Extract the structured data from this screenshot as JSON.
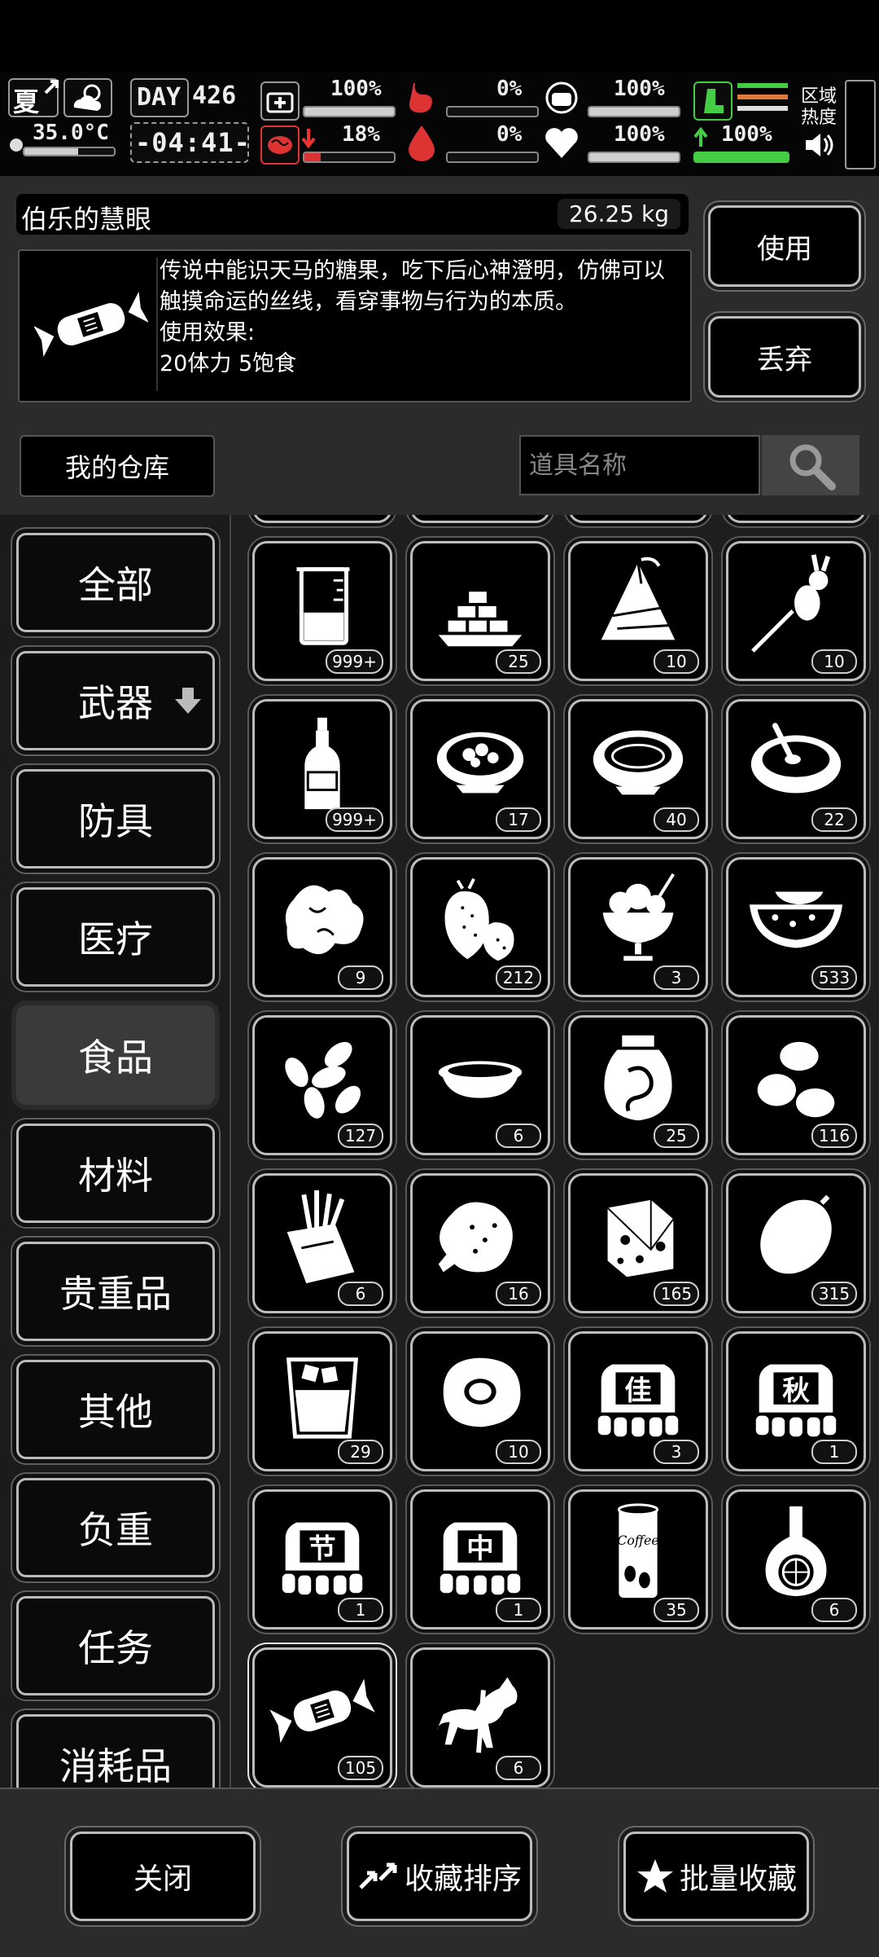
{
  "status": {
    "season": "夏",
    "temperature": "35.0°C",
    "day_label": "DAY",
    "day_number": "426",
    "time": "-04:41-",
    "stats": [
      {
        "name": "health",
        "text": "100%",
        "value": 100
      },
      {
        "name": "hunger",
        "text": "0%",
        "value": 0
      },
      {
        "name": "drink",
        "text": "100%",
        "value": 100
      },
      {
        "name": "brain",
        "text": "18%",
        "value": 18
      },
      {
        "name": "blood",
        "text": "0%",
        "value": 0
      },
      {
        "name": "heart",
        "text": "100%",
        "value": 100
      }
    ],
    "stamina": {
      "text": "100%",
      "value": 100
    },
    "zone_heat_label": "区域热度"
  },
  "detail": {
    "item_name": "伯乐的慧眼",
    "weight": "26.25 kg",
    "description": "传说中能识天马的糖果，吃下后心神澄明，仿佛可以触摸命运的丝线，看穿事物与行为的本质。",
    "effect_label": "使用效果:",
    "effect_value": "20体力 5饱食",
    "use_label": "使用",
    "discard_label": "丢弃"
  },
  "storage": {
    "title": "我的仓库",
    "search_placeholder": "道具名称"
  },
  "nav": [
    {
      "label": "全部"
    },
    {
      "label": "武器"
    },
    {
      "label": "防具"
    },
    {
      "label": "医疗"
    },
    {
      "label": "食品",
      "active": true
    },
    {
      "label": "材料"
    },
    {
      "label": "贵重品"
    },
    {
      "label": "其他"
    },
    {
      "label": "负重"
    },
    {
      "label": "任务"
    },
    {
      "label": "消耗品"
    }
  ],
  "items": [
    {
      "icon": "beaker-icon",
      "count": "999+"
    },
    {
      "icon": "gold-ingots-icon",
      "count": "25"
    },
    {
      "icon": "zongzi-icon",
      "count": "10"
    },
    {
      "icon": "rabbit-skewer-icon",
      "count": "10"
    },
    {
      "icon": "bottle-icon",
      "count": "999+"
    },
    {
      "icon": "stew-bowl-icon",
      "count": "17"
    },
    {
      "icon": "soup-bowl-icon",
      "count": "40"
    },
    {
      "icon": "porridge-bowl-icon",
      "count": "22"
    },
    {
      "icon": "ginger-icon",
      "count": "9"
    },
    {
      "icon": "strawberry-icon",
      "count": "212"
    },
    {
      "icon": "ice-cream-icon",
      "count": "3"
    },
    {
      "icon": "watermelon-icon",
      "count": "533"
    },
    {
      "icon": "seeds-icon",
      "count": "127"
    },
    {
      "icon": "small-bowl-icon",
      "count": "6"
    },
    {
      "icon": "jar-icon",
      "count": "25"
    },
    {
      "icon": "beans-icon",
      "count": "116"
    },
    {
      "icon": "fries-icon",
      "count": "6"
    },
    {
      "icon": "fried-chicken-icon",
      "count": "16"
    },
    {
      "icon": "cheese-icon",
      "count": "165"
    },
    {
      "icon": "lemon-icon",
      "count": "315"
    },
    {
      "icon": "iced-drink-icon",
      "count": "29"
    },
    {
      "icon": "fried-egg-icon",
      "count": "10"
    },
    {
      "icon": "mooncake-jia-icon",
      "count": "3",
      "char": "佳"
    },
    {
      "icon": "mooncake-qiu-icon",
      "count": "1",
      "char": "秋"
    },
    {
      "icon": "mooncake-jie-icon",
      "count": "1",
      "char": "节"
    },
    {
      "icon": "mooncake-zhong-icon",
      "count": "1",
      "char": "中"
    },
    {
      "icon": "coffee-can-icon",
      "count": "35",
      "label": "Coffee"
    },
    {
      "icon": "cognac-bottle-icon",
      "count": "6"
    },
    {
      "icon": "candy-icon",
      "count": "105",
      "selected": true
    },
    {
      "icon": "horse-icon",
      "count": "6"
    }
  ],
  "bottom": {
    "close_label": "关闭",
    "sort_label": "收藏排序",
    "batch_label": "批量收藏"
  }
}
